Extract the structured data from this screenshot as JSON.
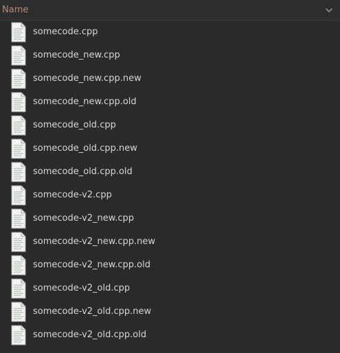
{
  "header": {
    "name_label": "Name",
    "sort_icon": "chevron-down-icon"
  },
  "files": [
    {
      "name": "somecode.cpp",
      "icon": "text-file-icon"
    },
    {
      "name": "somecode_new.cpp",
      "icon": "text-file-icon"
    },
    {
      "name": "somecode_new.cpp.new",
      "icon": "text-file-icon"
    },
    {
      "name": "somecode_new.cpp.old",
      "icon": "text-file-icon"
    },
    {
      "name": "somecode_old.cpp",
      "icon": "text-file-icon"
    },
    {
      "name": "somecode_old.cpp.new",
      "icon": "text-file-icon"
    },
    {
      "name": "somecode_old.cpp.old",
      "icon": "text-file-icon"
    },
    {
      "name": "somecode-v2.cpp",
      "icon": "text-file-icon"
    },
    {
      "name": "somecode-v2_new.cpp",
      "icon": "text-file-icon"
    },
    {
      "name": "somecode-v2_new.cpp.new",
      "icon": "text-file-icon"
    },
    {
      "name": "somecode-v2_new.cpp.old",
      "icon": "text-file-icon"
    },
    {
      "name": "somecode-v2_old.cpp",
      "icon": "text-file-icon"
    },
    {
      "name": "somecode-v2_old.cpp.new",
      "icon": "text-file-icon"
    },
    {
      "name": "somecode-v2_old.cpp.old",
      "icon": "text-file-icon"
    }
  ]
}
